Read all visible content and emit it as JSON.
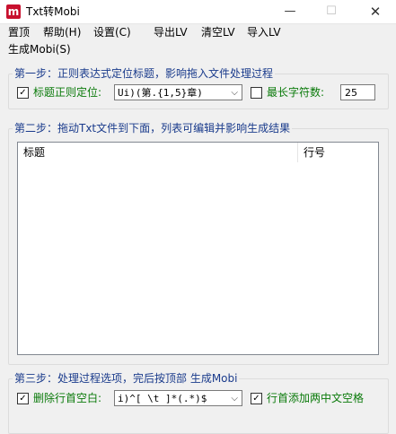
{
  "window": {
    "title": "Txt转Mobi",
    "icon_letter": "m",
    "minimize_glyph": "—",
    "maximize_glyph": "☐",
    "close_glyph": "✕"
  },
  "menu": {
    "item1": "置顶",
    "item2": "帮助(H)",
    "item3": "设置(C)",
    "item4": "导出LV",
    "item5": "清空LV",
    "item6": "导入LV",
    "item7": "生成Mobi(S)"
  },
  "step1": {
    "title": "第一步：正则表达式定位标题，影响拖入文件处理过程",
    "regex_checkbox_checked": true,
    "regex_label": "标题正则定位:",
    "regex_value": "Ui)(第.{1,5}章)",
    "maxlen_checkbox_checked": false,
    "maxlen_label": "最长字符数:",
    "maxlen_value": "25"
  },
  "step2": {
    "title": "第二步：拖动Txt文件到下面，列表可编辑并影响生成结果",
    "columns": [
      "标题",
      "行号"
    ]
  },
  "step3": {
    "title": "第三步：处理过程选项，完后按顶部 生成Mobi",
    "trim_checkbox_checked": true,
    "trim_label": "删除行首空白:",
    "trim_value": "i)^[ \\t  ]*(.*)$",
    "indent_checkbox_checked": true,
    "indent_label": "行首添加两中文空格"
  },
  "glyphs": {
    "check": "✓",
    "dropdown": "⌵"
  }
}
